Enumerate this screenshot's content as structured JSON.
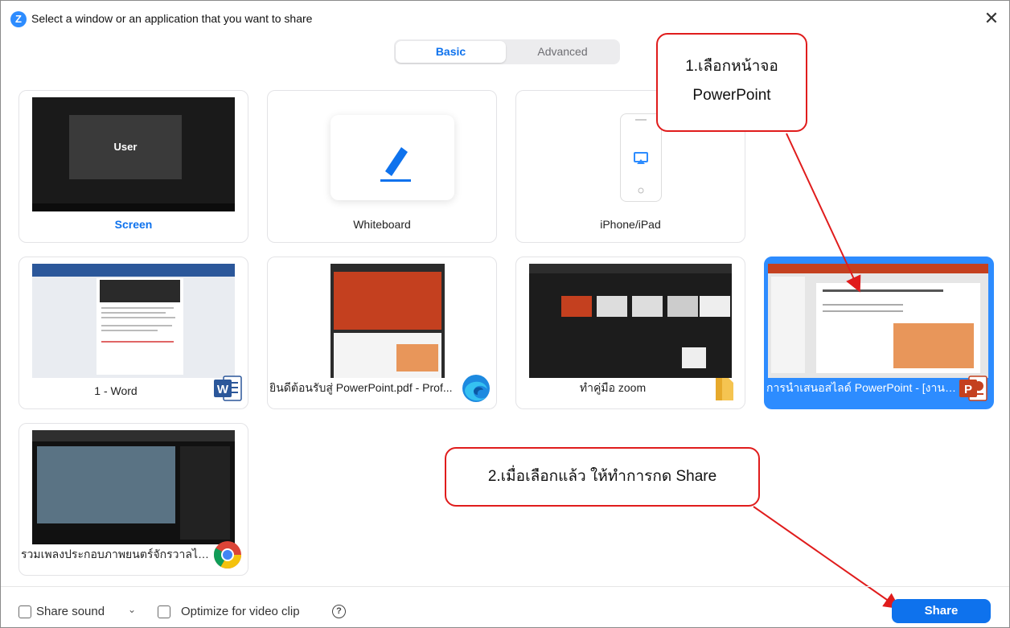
{
  "window": {
    "title": "Select a window or an application that you want to share",
    "app_icon_letter": "Z",
    "close_glyph": "✕"
  },
  "tabs": [
    {
      "label": "Basic",
      "selected": true
    },
    {
      "label": "Advanced",
      "selected": false
    }
  ],
  "tiles": [
    {
      "label": "Screen",
      "thumb_text": "User",
      "selected": false
    },
    {
      "label": "Whiteboard",
      "selected": false
    },
    {
      "label": "iPhone/iPad",
      "selected": false
    },
    {
      "label": "1 - Word",
      "app_icon": "word-icon",
      "selected": false
    },
    {
      "label": "ยินดีต้อนรับสู่ PowerPoint.pdf - Prof...",
      "app_icon": "edge-icon",
      "selected": false
    },
    {
      "label": "ทำคู่มือ zoom",
      "app_icon": "folder-icon",
      "selected": false
    },
    {
      "label": "การนำเสนอสไลด์ PowerPoint - [งานน...",
      "app_icon": "powerpoint-icon",
      "selected": true
    },
    {
      "label": "รวมเพลงประกอบภาพยนตร์จักรวาลไทบ้า...",
      "app_icon": "chrome-icon",
      "selected": false
    }
  ],
  "annotations": {
    "callout_1_line1": "1.เลือกหน้าจอ",
    "callout_1_line2": "PowerPoint",
    "callout_2": "2.เมื่อเลือกแล้ว ให้ทำการกด Share"
  },
  "bottom": {
    "share_sound_label": "Share sound",
    "share_sound_checked": false,
    "optimize_label": "Optimize for video clip",
    "optimize_checked": false,
    "help_glyph": "?",
    "share_button": "Share"
  },
  "colors": {
    "accent": "#0e72ed",
    "selected_tile": "#2d8cff",
    "annotation": "#e01c1c"
  }
}
